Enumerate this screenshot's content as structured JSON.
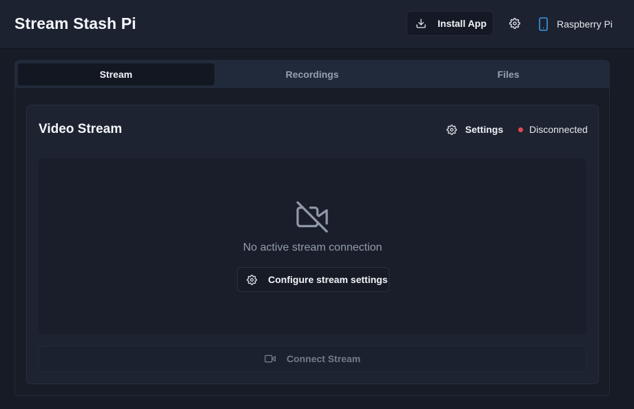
{
  "app": {
    "title": "Stream Stash Pi"
  },
  "header": {
    "install_label": "Install App",
    "device_name": "Raspberry Pi",
    "device_icon": "smartphone-icon",
    "settings_icon": "gear-icon"
  },
  "tabs": [
    {
      "label": "Stream",
      "active": true
    },
    {
      "label": "Recordings",
      "active": false
    },
    {
      "label": "Files",
      "active": false
    }
  ],
  "stream_card": {
    "title": "Video Stream",
    "settings_label": "Settings",
    "status_label": "Disconnected",
    "status_color": "#e5484d",
    "empty_icon": "video-off-icon",
    "empty_message": "No active stream connection",
    "configure_label": "Configure stream settings",
    "connect_label": "Connect Stream",
    "connect_enabled": false
  },
  "colors": {
    "accent": "#3b9ae8",
    "background": "#161b26",
    "surface": "#1d2331"
  }
}
